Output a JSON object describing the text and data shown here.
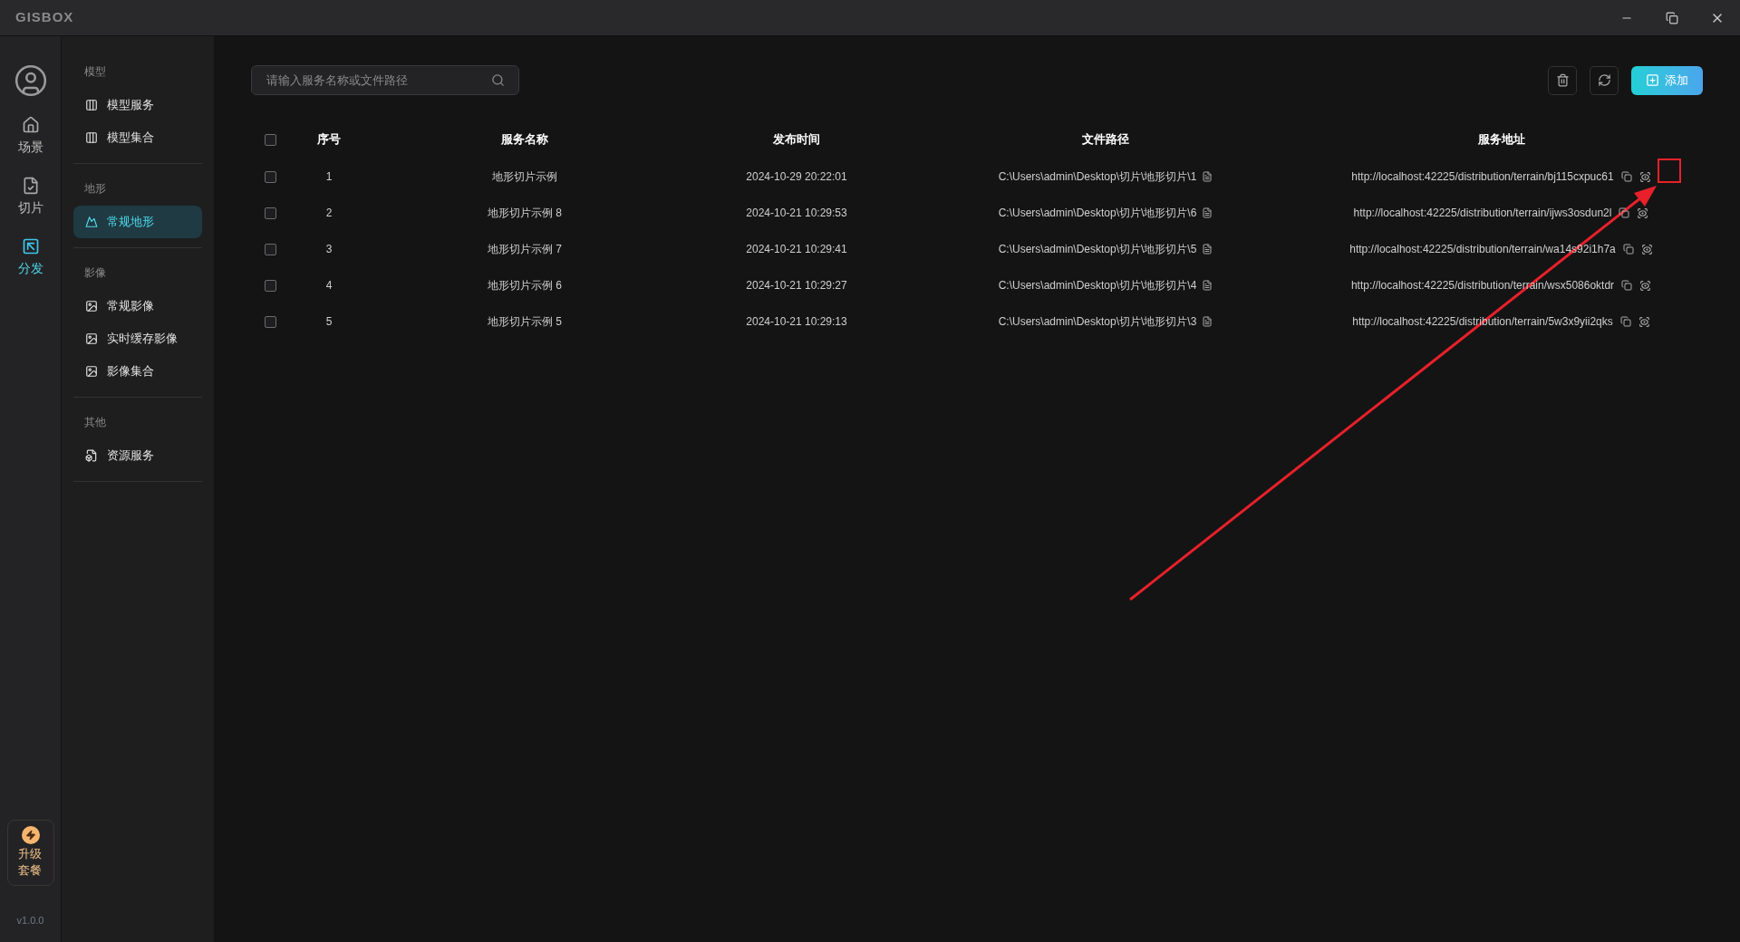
{
  "title_bar": {
    "logo": "GISBOX"
  },
  "rail": {
    "items": [
      {
        "label": "场景",
        "selected": false
      },
      {
        "label": "切片",
        "selected": false
      },
      {
        "label": "分发",
        "selected": true
      }
    ],
    "upgrade": "升级套餐",
    "version": "v1.0.0"
  },
  "sidebar": {
    "sections": [
      {
        "heading": "模型",
        "items": [
          {
            "label": "模型服务",
            "selected": false
          },
          {
            "label": "模型集合",
            "selected": false
          }
        ]
      },
      {
        "heading": "地形",
        "items": [
          {
            "label": "常规地形",
            "selected": true
          }
        ]
      },
      {
        "heading": "影像",
        "items": [
          {
            "label": "常规影像",
            "selected": false
          },
          {
            "label": "实时缓存影像",
            "selected": false
          },
          {
            "label": "影像集合",
            "selected": false
          }
        ]
      },
      {
        "heading": "其他",
        "items": [
          {
            "label": "资源服务",
            "selected": false
          }
        ]
      }
    ]
  },
  "search": {
    "placeholder": "请输入服务名称或文件路径"
  },
  "toolbar": {
    "add_label": "添加"
  },
  "table": {
    "select_all_checked": false,
    "columns": [
      "序号",
      "服务名称",
      "发布时间",
      "文件路径",
      "服务地址"
    ],
    "rows": [
      {
        "checked": false,
        "index": "1",
        "name": "地形切片示例",
        "time": "2024-10-29 20:22:01",
        "path": "C:\\Users\\admin\\Desktop\\切片\\地形切片\\1",
        "url": "http://localhost:42225/distribution/terrain/bj115cxpuc61"
      },
      {
        "checked": false,
        "index": "2",
        "name": "地形切片示例 8",
        "time": "2024-10-21 10:29:53",
        "path": "C:\\Users\\admin\\Desktop\\切片\\地形切片\\6",
        "url": "http://localhost:42225/distribution/terrain/ijws3osdun2l"
      },
      {
        "checked": false,
        "index": "3",
        "name": "地形切片示例 7",
        "time": "2024-10-21 10:29:41",
        "path": "C:\\Users\\admin\\Desktop\\切片\\地形切片\\5",
        "url": "http://localhost:42225/distribution/terrain/wa14s92i1h7a"
      },
      {
        "checked": false,
        "index": "4",
        "name": "地形切片示例 6",
        "time": "2024-10-21 10:29:27",
        "path": "C:\\Users\\admin\\Desktop\\切片\\地形切片\\4",
        "url": "http://localhost:42225/distribution/terrain/wsx5086oktdr"
      },
      {
        "checked": false,
        "index": "5",
        "name": "地形切片示例 5",
        "time": "2024-10-21 10:29:13",
        "path": "C:\\Users\\admin\\Desktop\\切片\\地形切片\\3",
        "url": "http://localhost:42225/distribution/terrain/5w3x9yii2qks"
      }
    ]
  }
}
